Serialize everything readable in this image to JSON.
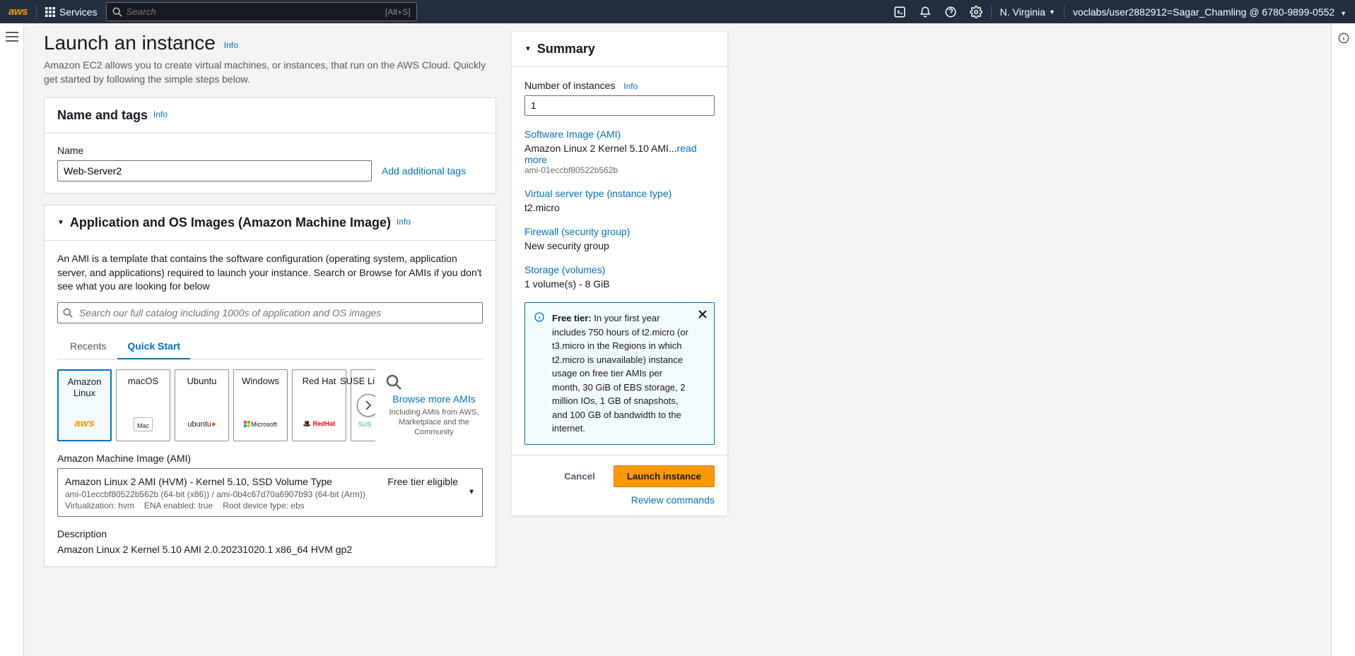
{
  "topnav": {
    "logo": "aws",
    "services": "Services",
    "search_placeholder": "Search",
    "search_shortcut": "[Alt+S]",
    "region": "N. Virginia",
    "user": "voclabs/user2882912=Sagar_Chamling @ 6780-9899-0552"
  },
  "header": {
    "title": "Launch an instance",
    "info": "Info",
    "desc": "Amazon EC2 allows you to create virtual machines, or instances, that run on the AWS Cloud. Quickly get started by following the simple steps below."
  },
  "name_panel": {
    "title": "Name and tags",
    "info": "Info",
    "name_label": "Name",
    "name_value": "Web-Server2",
    "add_tags": "Add additional tags"
  },
  "ami_panel": {
    "title": "Application and OS Images (Amazon Machine Image)",
    "info": "Info",
    "desc": "An AMI is a template that contains the software configuration (operating system, application server, and applications) required to launch your instance. Search or Browse for AMIs if you don't see what you are looking for below",
    "search_placeholder": "Search our full catalog including 1000s of application and OS images",
    "tab_recents": "Recents",
    "tab_quick": "Quick Start",
    "os": {
      "amazon": "Amazon Linux",
      "macos": "macOS",
      "ubuntu": "Ubuntu",
      "windows": "Windows",
      "redhat": "Red Hat",
      "suse": "SUSE Linux"
    },
    "browse_title": "Browse more AMIs",
    "browse_sub": "Including AMIs from AWS, Marketplace and the Community",
    "ami_field_label": "Amazon Machine Image (AMI)",
    "selected_ami": {
      "title": "Amazon Linux 2 AMI (HVM) - Kernel 5.10, SSD Volume Type",
      "free": "Free tier eligible",
      "meta": "ami-01eccbf80522b562b (64-bit (x86)) / ami-0b4c67d70a6907b93 (64-bit (Arm))",
      "virt": "Virtualization: hvm",
      "ena": "ENA enabled: true",
      "root": "Root device type: ebs"
    },
    "descr_label": "Description",
    "descr_val": "Amazon Linux 2 Kernel 5.10 AMI 2.0.20231020.1 x86_64 HVM gp2"
  },
  "summary": {
    "title": "Summary",
    "num_label": "Number of instances",
    "info": "Info",
    "num_val": "1",
    "soft_label": "Software Image (AMI)",
    "soft_val": "Amazon Linux 2 Kernel 5.10 AMI...",
    "read_more": "read more",
    "soft_sub": "ami-01eccbf80522b562b",
    "type_label": "Virtual server type (instance type)",
    "type_val": "t2.micro",
    "fw_label": "Firewall (security group)",
    "fw_val": "New security group",
    "stor_label": "Storage (volumes)",
    "stor_val": "1 volume(s) - 8 GiB",
    "free_tier_bold": "Free tier:",
    "free_tier": " In your first year includes 750 hours of t2.micro (or t3.micro in the Regions in which t2.micro is unavailable) instance usage on free tier AMIs per month, 30 GiB of EBS storage, 2 million IOs, 1 GB of snapshots, and 100 GB of bandwidth to the internet.",
    "cancel": "Cancel",
    "launch": "Launch instance",
    "review": "Review commands"
  }
}
